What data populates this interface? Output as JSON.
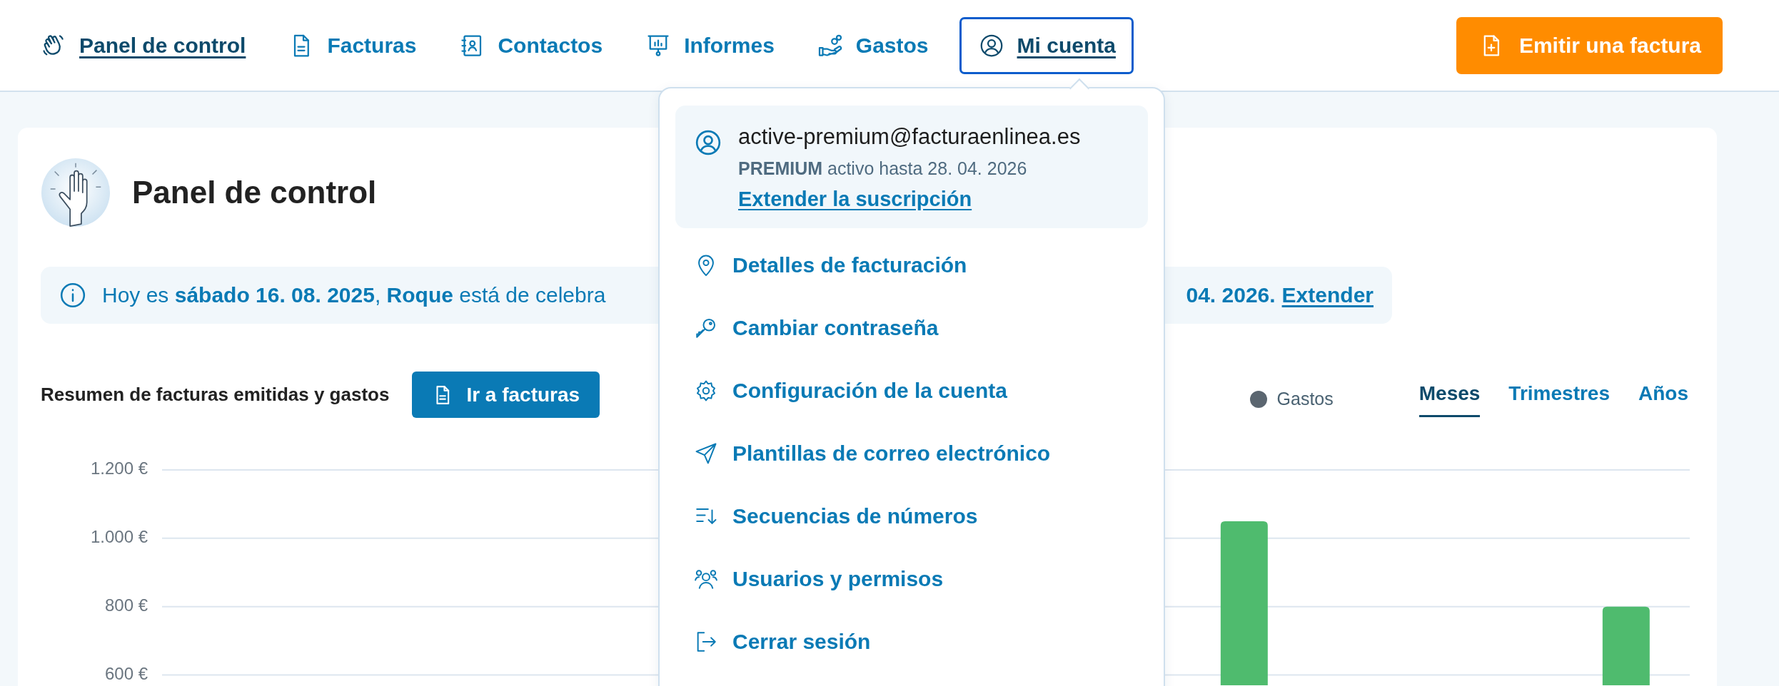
{
  "nav": {
    "items": [
      {
        "label": "Panel de control",
        "kind": "wave",
        "selected": true,
        "expanded": false
      },
      {
        "label": "Facturas",
        "kind": "document",
        "selected": false,
        "expanded": false
      },
      {
        "label": "Contactos",
        "kind": "contacts",
        "selected": false,
        "expanded": false
      },
      {
        "label": "Informes",
        "kind": "presentation",
        "selected": false,
        "expanded": false
      },
      {
        "label": "Gastos",
        "kind": "hand-coins",
        "selected": false,
        "expanded": false
      },
      {
        "label": "Mi cuenta",
        "kind": "user",
        "selected": true,
        "expanded": true
      }
    ],
    "cta": "Emitir una factura"
  },
  "dashboard": {
    "title": "Panel de control",
    "info": {
      "text": "Hoy es **sábado 16. 08. 2025**, **Roque** está de celebra",
      "text_end": "04. 2026.",
      "link": "Extender"
    },
    "summary": {
      "title": "Resumen de facturas emitidas y gastos",
      "button": "Ir a facturas",
      "legend": [
        {
          "label": "Gastos",
          "color": "#5b6670"
        }
      ],
      "periods": [
        {
          "label": "Meses",
          "selected": true
        },
        {
          "label": "Trimestres",
          "selected": false
        },
        {
          "label": "Años",
          "selected": false
        }
      ],
      "chart_data": {
        "type": "bar",
        "ylim": [
          570,
          1200
        ],
        "grid": true,
        "yticks": [
          {
            "value": 600,
            "label": "600 €"
          },
          {
            "value": 800,
            "label": "800 €"
          },
          {
            "value": 1000,
            "label": "1.000 €"
          },
          {
            "value": 1200,
            "label": "1.200 €"
          }
        ],
        "series": [
          {
            "color": "#4fbb6e",
            "values": [
              null,
              null,
              null,
              null,
              null,
              null,
              null,
              null,
              1050,
              null,
              null,
              800
            ]
          }
        ]
      }
    }
  },
  "account_menu": {
    "email": "active-premium@facturaenlinea.es",
    "plan": "**PREMIUM** activo hasta 28. 04. 2026",
    "link": "Extender la suscripción",
    "items": [
      {
        "label": "Detalles de facturación",
        "kind": "pin"
      },
      {
        "label": "Cambiar contraseña",
        "kind": "key"
      },
      {
        "label": "Configuración de la cuenta",
        "kind": "gear"
      },
      {
        "label": "Plantillas de correo electrónico",
        "kind": "send"
      },
      {
        "label": "Secuencias de números",
        "kind": "sort"
      },
      {
        "label": "Usuarios y permisos",
        "kind": "users"
      },
      {
        "label": "Cerrar sesión",
        "kind": "logout"
      }
    ]
  }
}
